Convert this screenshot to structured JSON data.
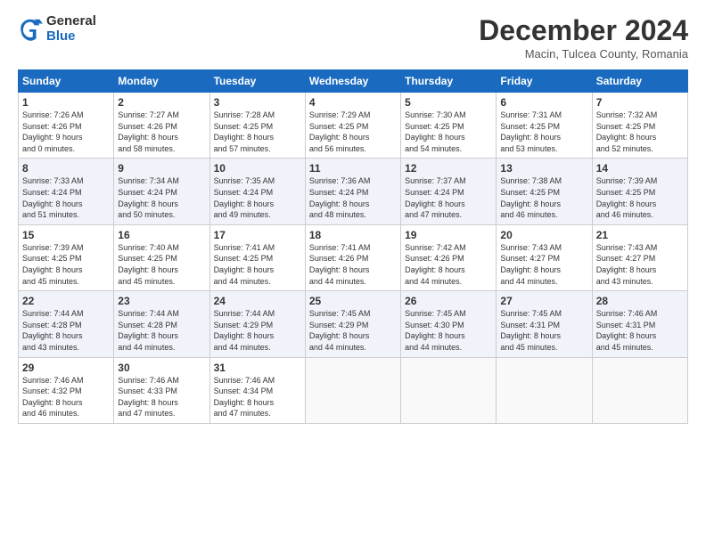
{
  "logo": {
    "general": "General",
    "blue": "Blue"
  },
  "header": {
    "title": "December 2024",
    "subtitle": "Macin, Tulcea County, Romania"
  },
  "calendar": {
    "days_of_week": [
      "Sunday",
      "Monday",
      "Tuesday",
      "Wednesday",
      "Thursday",
      "Friday",
      "Saturday"
    ],
    "weeks": [
      [
        {
          "day": "1",
          "info": "Sunrise: 7:26 AM\nSunset: 4:26 PM\nDaylight: 9 hours\nand 0 minutes."
        },
        {
          "day": "2",
          "info": "Sunrise: 7:27 AM\nSunset: 4:26 PM\nDaylight: 8 hours\nand 58 minutes."
        },
        {
          "day": "3",
          "info": "Sunrise: 7:28 AM\nSunset: 4:25 PM\nDaylight: 8 hours\nand 57 minutes."
        },
        {
          "day": "4",
          "info": "Sunrise: 7:29 AM\nSunset: 4:25 PM\nDaylight: 8 hours\nand 56 minutes."
        },
        {
          "day": "5",
          "info": "Sunrise: 7:30 AM\nSunset: 4:25 PM\nDaylight: 8 hours\nand 54 minutes."
        },
        {
          "day": "6",
          "info": "Sunrise: 7:31 AM\nSunset: 4:25 PM\nDaylight: 8 hours\nand 53 minutes."
        },
        {
          "day": "7",
          "info": "Sunrise: 7:32 AM\nSunset: 4:25 PM\nDaylight: 8 hours\nand 52 minutes."
        }
      ],
      [
        {
          "day": "8",
          "info": "Sunrise: 7:33 AM\nSunset: 4:24 PM\nDaylight: 8 hours\nand 51 minutes."
        },
        {
          "day": "9",
          "info": "Sunrise: 7:34 AM\nSunset: 4:24 PM\nDaylight: 8 hours\nand 50 minutes."
        },
        {
          "day": "10",
          "info": "Sunrise: 7:35 AM\nSunset: 4:24 PM\nDaylight: 8 hours\nand 49 minutes."
        },
        {
          "day": "11",
          "info": "Sunrise: 7:36 AM\nSunset: 4:24 PM\nDaylight: 8 hours\nand 48 minutes."
        },
        {
          "day": "12",
          "info": "Sunrise: 7:37 AM\nSunset: 4:24 PM\nDaylight: 8 hours\nand 47 minutes."
        },
        {
          "day": "13",
          "info": "Sunrise: 7:38 AM\nSunset: 4:25 PM\nDaylight: 8 hours\nand 46 minutes."
        },
        {
          "day": "14",
          "info": "Sunrise: 7:39 AM\nSunset: 4:25 PM\nDaylight: 8 hours\nand 46 minutes."
        }
      ],
      [
        {
          "day": "15",
          "info": "Sunrise: 7:39 AM\nSunset: 4:25 PM\nDaylight: 8 hours\nand 45 minutes."
        },
        {
          "day": "16",
          "info": "Sunrise: 7:40 AM\nSunset: 4:25 PM\nDaylight: 8 hours\nand 45 minutes."
        },
        {
          "day": "17",
          "info": "Sunrise: 7:41 AM\nSunset: 4:25 PM\nDaylight: 8 hours\nand 44 minutes."
        },
        {
          "day": "18",
          "info": "Sunrise: 7:41 AM\nSunset: 4:26 PM\nDaylight: 8 hours\nand 44 minutes."
        },
        {
          "day": "19",
          "info": "Sunrise: 7:42 AM\nSunset: 4:26 PM\nDaylight: 8 hours\nand 44 minutes."
        },
        {
          "day": "20",
          "info": "Sunrise: 7:43 AM\nSunset: 4:27 PM\nDaylight: 8 hours\nand 44 minutes."
        },
        {
          "day": "21",
          "info": "Sunrise: 7:43 AM\nSunset: 4:27 PM\nDaylight: 8 hours\nand 43 minutes."
        }
      ],
      [
        {
          "day": "22",
          "info": "Sunrise: 7:44 AM\nSunset: 4:28 PM\nDaylight: 8 hours\nand 43 minutes."
        },
        {
          "day": "23",
          "info": "Sunrise: 7:44 AM\nSunset: 4:28 PM\nDaylight: 8 hours\nand 44 minutes."
        },
        {
          "day": "24",
          "info": "Sunrise: 7:44 AM\nSunset: 4:29 PM\nDaylight: 8 hours\nand 44 minutes."
        },
        {
          "day": "25",
          "info": "Sunrise: 7:45 AM\nSunset: 4:29 PM\nDaylight: 8 hours\nand 44 minutes."
        },
        {
          "day": "26",
          "info": "Sunrise: 7:45 AM\nSunset: 4:30 PM\nDaylight: 8 hours\nand 44 minutes."
        },
        {
          "day": "27",
          "info": "Sunrise: 7:45 AM\nSunset: 4:31 PM\nDaylight: 8 hours\nand 45 minutes."
        },
        {
          "day": "28",
          "info": "Sunrise: 7:46 AM\nSunset: 4:31 PM\nDaylight: 8 hours\nand 45 minutes."
        }
      ],
      [
        {
          "day": "29",
          "info": "Sunrise: 7:46 AM\nSunset: 4:32 PM\nDaylight: 8 hours\nand 46 minutes."
        },
        {
          "day": "30",
          "info": "Sunrise: 7:46 AM\nSunset: 4:33 PM\nDaylight: 8 hours\nand 47 minutes."
        },
        {
          "day": "31",
          "info": "Sunrise: 7:46 AM\nSunset: 4:34 PM\nDaylight: 8 hours\nand 47 minutes."
        },
        {
          "day": "",
          "info": ""
        },
        {
          "day": "",
          "info": ""
        },
        {
          "day": "",
          "info": ""
        },
        {
          "day": "",
          "info": ""
        }
      ]
    ]
  }
}
